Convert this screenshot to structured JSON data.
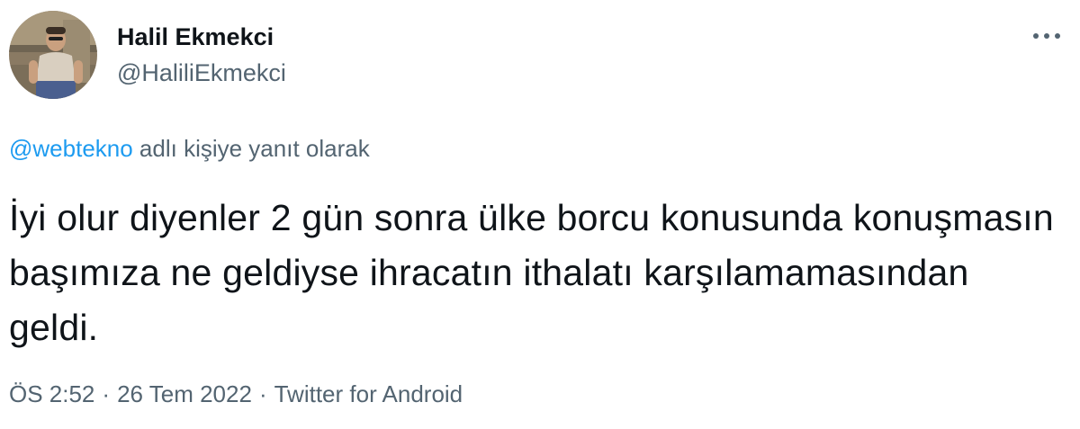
{
  "author": {
    "display_name": "Halil Ekmekci",
    "handle": "@HaliliEkmekci"
  },
  "menu": {
    "more_icon": "more-horizontal-icon",
    "dots": "•••"
  },
  "reply_context": {
    "mention": "@webtekno",
    "suffix": " adlı kişiye yanıt olarak"
  },
  "tweet": {
    "text": "İyi olur diyenler 2 gün sonra ülke borcu konusunda konuşmasın başımıza ne geldiyse ihracatın ithalatı karşılamamasından geldi."
  },
  "meta": {
    "time": "ÖS 2:52",
    "separator": "·",
    "date": "26 Tem 2022",
    "source": "Twitter for Android"
  },
  "colors": {
    "text_primary": "#0f1419",
    "text_secondary": "#536471",
    "link": "#1d9bf0"
  }
}
